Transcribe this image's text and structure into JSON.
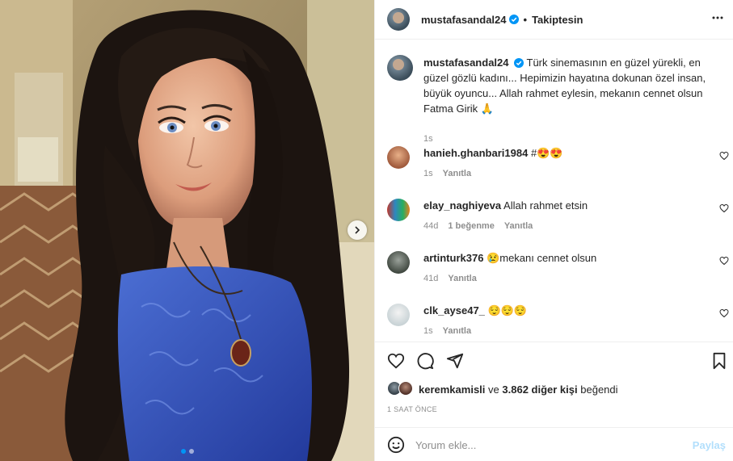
{
  "post": {
    "username": "mustafasandal24",
    "follow_state": "Takiptesin",
    "caption": "Türk sinemasının en güzel yürekli, en güzel gözlü kadını... Hepimizin hayatına dokunan özel insan, büyük oyuncu... Allah rahmet eylesin, mekanın cennet olsun Fatma Girik 🙏",
    "caption_time": "1s"
  },
  "comments": [
    {
      "user": "hanieh.ghanbari1984",
      "text": "#😍😍",
      "time": "1s",
      "likes": "",
      "reply": "Yanıtla"
    },
    {
      "user": "elay_naghiyeva",
      "text": "Allah rahmet etsin",
      "time": "44d",
      "likes": "1 beğenme",
      "reply": "Yanıtla"
    },
    {
      "user": "artinturk376",
      "text": "😢mekanı cennet olsun",
      "time": "41d",
      "likes": "",
      "reply": "Yanıtla"
    },
    {
      "user": "clk_ayse47_",
      "text": "😌😌😌",
      "time": "1s",
      "likes": "",
      "reply": "Yanıtla"
    }
  ],
  "likes": {
    "liker": "keremkamisli",
    "connector": "ve",
    "others": "3.862 diğer kişi",
    "suffix": "beğendi"
  },
  "timestamp": "1 SAAT ÖNCE",
  "add_comment": {
    "placeholder": "Yorum ekle...",
    "share": "Paylaş"
  },
  "icons": {
    "verified": "verified-badge-icon",
    "more": "more-horizontal-icon",
    "like": "heart-icon",
    "comment": "comment-icon",
    "share": "paper-plane-icon",
    "save": "bookmark-icon",
    "emoji": "smiley-icon",
    "next": "chevron-right-icon"
  },
  "colors": {
    "verified": "#0095f6",
    "share_disabled": "#b2dffc",
    "text": "#262626",
    "muted": "#8e8e8e"
  },
  "carousel": {
    "count": 2,
    "active": 1
  }
}
